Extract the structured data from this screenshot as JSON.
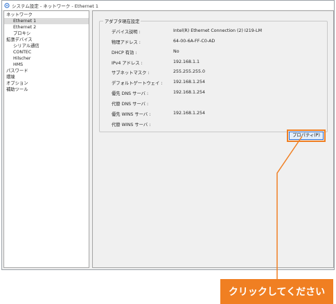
{
  "window": {
    "title": "システム設定 - ネットワーク - Ethernet 1",
    "icon": "settings-app-icon"
  },
  "tree": {
    "items": [
      {
        "label": "ネットワーク",
        "selected": false
      },
      {
        "label": "Ethernet 1",
        "selected": true
      },
      {
        "label": "Ethernet 2",
        "selected": false
      },
      {
        "label": "プロキシ",
        "selected": false
      },
      {
        "label": "拡張デバイス",
        "selected": false
      },
      {
        "label": "シリアル通信",
        "selected": false
      },
      {
        "label": "CONTEC",
        "selected": false
      },
      {
        "label": "Hilscher",
        "selected": false
      },
      {
        "label": "HMS",
        "selected": false
      },
      {
        "label": "パスワード",
        "selected": false
      },
      {
        "label": "環境",
        "selected": false
      },
      {
        "label": "オプション",
        "selected": false
      },
      {
        "label": "補助ツール",
        "selected": false
      }
    ]
  },
  "adapter": {
    "group_title": "アダプタ現在設定",
    "rows": [
      {
        "label": "デバイス説明 :",
        "value": "Intel(R) Ethernet Connection (2) I219-LM"
      },
      {
        "label": "物理アドレス :",
        "value": "64-00-6A-FF-C0-AD"
      },
      {
        "label": "DHCP 有効 :",
        "value": "No"
      },
      {
        "label": "IPv4 アドレス :",
        "value": "192.168.1.1"
      },
      {
        "label": "サブネットマスク :",
        "value": "255.255.255.0"
      },
      {
        "label": "デフォルトゲートウェイ :",
        "value": "192.168.1.254"
      },
      {
        "label": "優先 DNS サーバ :",
        "value": "192.168.1.254"
      },
      {
        "label": "代替 DNS サーバ :",
        "value": ""
      },
      {
        "label": "優先 WINS サーバ :",
        "value": "192.168.1.254"
      },
      {
        "label": "代替 WINS サーバ :",
        "value": ""
      }
    ],
    "properties_button": "プロパティ(P)"
  },
  "callout": {
    "text": "クリックしてください",
    "color": "#f07f22"
  }
}
